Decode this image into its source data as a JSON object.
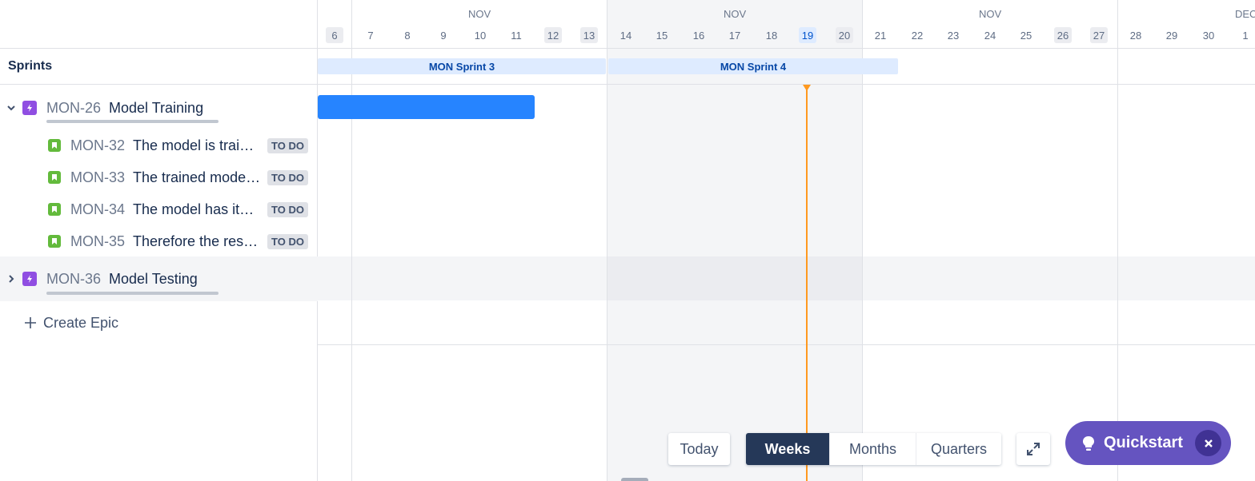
{
  "timeline_header": {
    "months": [
      "NOV",
      "NOV",
      "NOV",
      "DEC"
    ],
    "days": [
      "6",
      "7",
      "8",
      "9",
      "10",
      "11",
      "12",
      "13",
      "14",
      "15",
      "16",
      "17",
      "18",
      "19",
      "20",
      "21",
      "22",
      "23",
      "24",
      "25",
      "26",
      "27",
      "28",
      "29",
      "30",
      "1"
    ]
  },
  "sprints": {
    "label": "Sprints",
    "items": [
      {
        "name": "MON Sprint 3"
      },
      {
        "name": "MON Sprint 4"
      }
    ]
  },
  "epics": [
    {
      "key": "MON-26",
      "summary": "Model Training",
      "expanded": true,
      "stories": [
        {
          "key": "MON-32",
          "summary": "The model is traine...",
          "status": "TO DO"
        },
        {
          "key": "MON-33",
          "summary": "The trained model ...",
          "status": "TO DO"
        },
        {
          "key": "MON-34",
          "summary": "The model has its ...",
          "status": "TO DO"
        },
        {
          "key": "MON-35",
          "summary": "Therefore the resul...",
          "status": "TO DO"
        }
      ]
    },
    {
      "key": "MON-36",
      "summary": "Model Testing",
      "expanded": false,
      "stories": []
    }
  ],
  "create_epic_label": "Create Epic",
  "controls": {
    "today": "Today",
    "views": [
      "Weeks",
      "Months",
      "Quarters"
    ],
    "active_view": "Weeks"
  },
  "quickstart": {
    "label": "Quickstart"
  },
  "colors": {
    "epic_bar": "#2684ff",
    "today_line": "#ff991f",
    "sprint_bg": "#deebff",
    "active_toggle": "#253858",
    "quickstart": "#6554c0"
  }
}
